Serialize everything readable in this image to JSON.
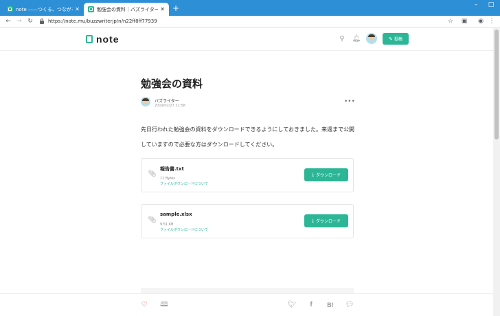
{
  "browser": {
    "tabs": [
      {
        "title": "note ――つくる、つながる、とどける。",
        "active": false
      },
      {
        "title": "勉強会の資料｜バズライター｜note",
        "active": true
      }
    ],
    "url": "https://note.mu/buzzwriterjp/n/n22ff8ff77939",
    "window_controls": {
      "minimize": "–",
      "maximize": "□",
      "close": "✕"
    }
  },
  "header": {
    "logo_text": "note",
    "post_button_label": "投稿"
  },
  "article": {
    "title": "勉強会の資料",
    "author_name": "バズライター",
    "date": "2019/02/27 21:58",
    "more_menu": "•••",
    "body": "先日行われた勉強会の資料をダウンロードできるようにしておきました。来週まで公開していますので必要な方はダウンロードしてください。"
  },
  "files": [
    {
      "name": "報告書.txt",
      "size": "11 Bytes",
      "help_link": "ファイルダウンロードについて",
      "download_label": "ダウンロード"
    },
    {
      "name": "sample.xlsx",
      "size": "9.51 KB",
      "help_link": "ファイルダウンロードについて",
      "download_label": "ダウンロード"
    }
  ],
  "footer": {
    "hatena_label": "B!"
  },
  "colors": {
    "accent": "#2cb696",
    "titlebar": "#2d8fd5",
    "like": "#e0464e"
  }
}
